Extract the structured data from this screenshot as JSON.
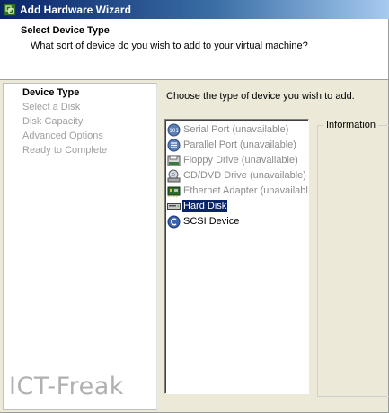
{
  "window": {
    "title": "Add Hardware Wizard",
    "icon": "vmware-wizard-icon"
  },
  "header": {
    "title": "Select Device Type",
    "subtitle": "What sort of device do you wish to add to your virtual machine?"
  },
  "steps": [
    {
      "label": "Device Type",
      "active": true
    },
    {
      "label": "Select a Disk",
      "active": false
    },
    {
      "label": "Disk Capacity",
      "active": false
    },
    {
      "label": "Advanced Options",
      "active": false
    },
    {
      "label": "Ready to Complete",
      "active": false
    }
  ],
  "content": {
    "prompt": "Choose the type of device you wish to add."
  },
  "devices": [
    {
      "label": "Serial Port (unavailable)",
      "icon": "serial-port-icon",
      "enabled": false,
      "selected": false
    },
    {
      "label": "Parallel Port (unavailable)",
      "icon": "parallel-port-icon",
      "enabled": false,
      "selected": false
    },
    {
      "label": "Floppy Drive (unavailable)",
      "icon": "floppy-drive-icon",
      "enabled": false,
      "selected": false
    },
    {
      "label": "CD/DVD Drive (unavailable)",
      "icon": "cd-dvd-drive-icon",
      "enabled": false,
      "selected": false
    },
    {
      "label": "Ethernet Adapter (unavailable)",
      "icon": "ethernet-adapter-icon",
      "enabled": false,
      "selected": false
    },
    {
      "label": "Hard Disk",
      "icon": "hard-disk-icon",
      "enabled": true,
      "selected": true
    },
    {
      "label": "SCSI Device",
      "icon": "scsi-device-icon",
      "enabled": true,
      "selected": false
    }
  ],
  "info_panel": {
    "label": "Information"
  },
  "watermark": "ICT-Freak",
  "colors": {
    "selection": "#0a246a",
    "title_bar_start": "#0a246a",
    "disabled_text": "#8c8c8c"
  }
}
